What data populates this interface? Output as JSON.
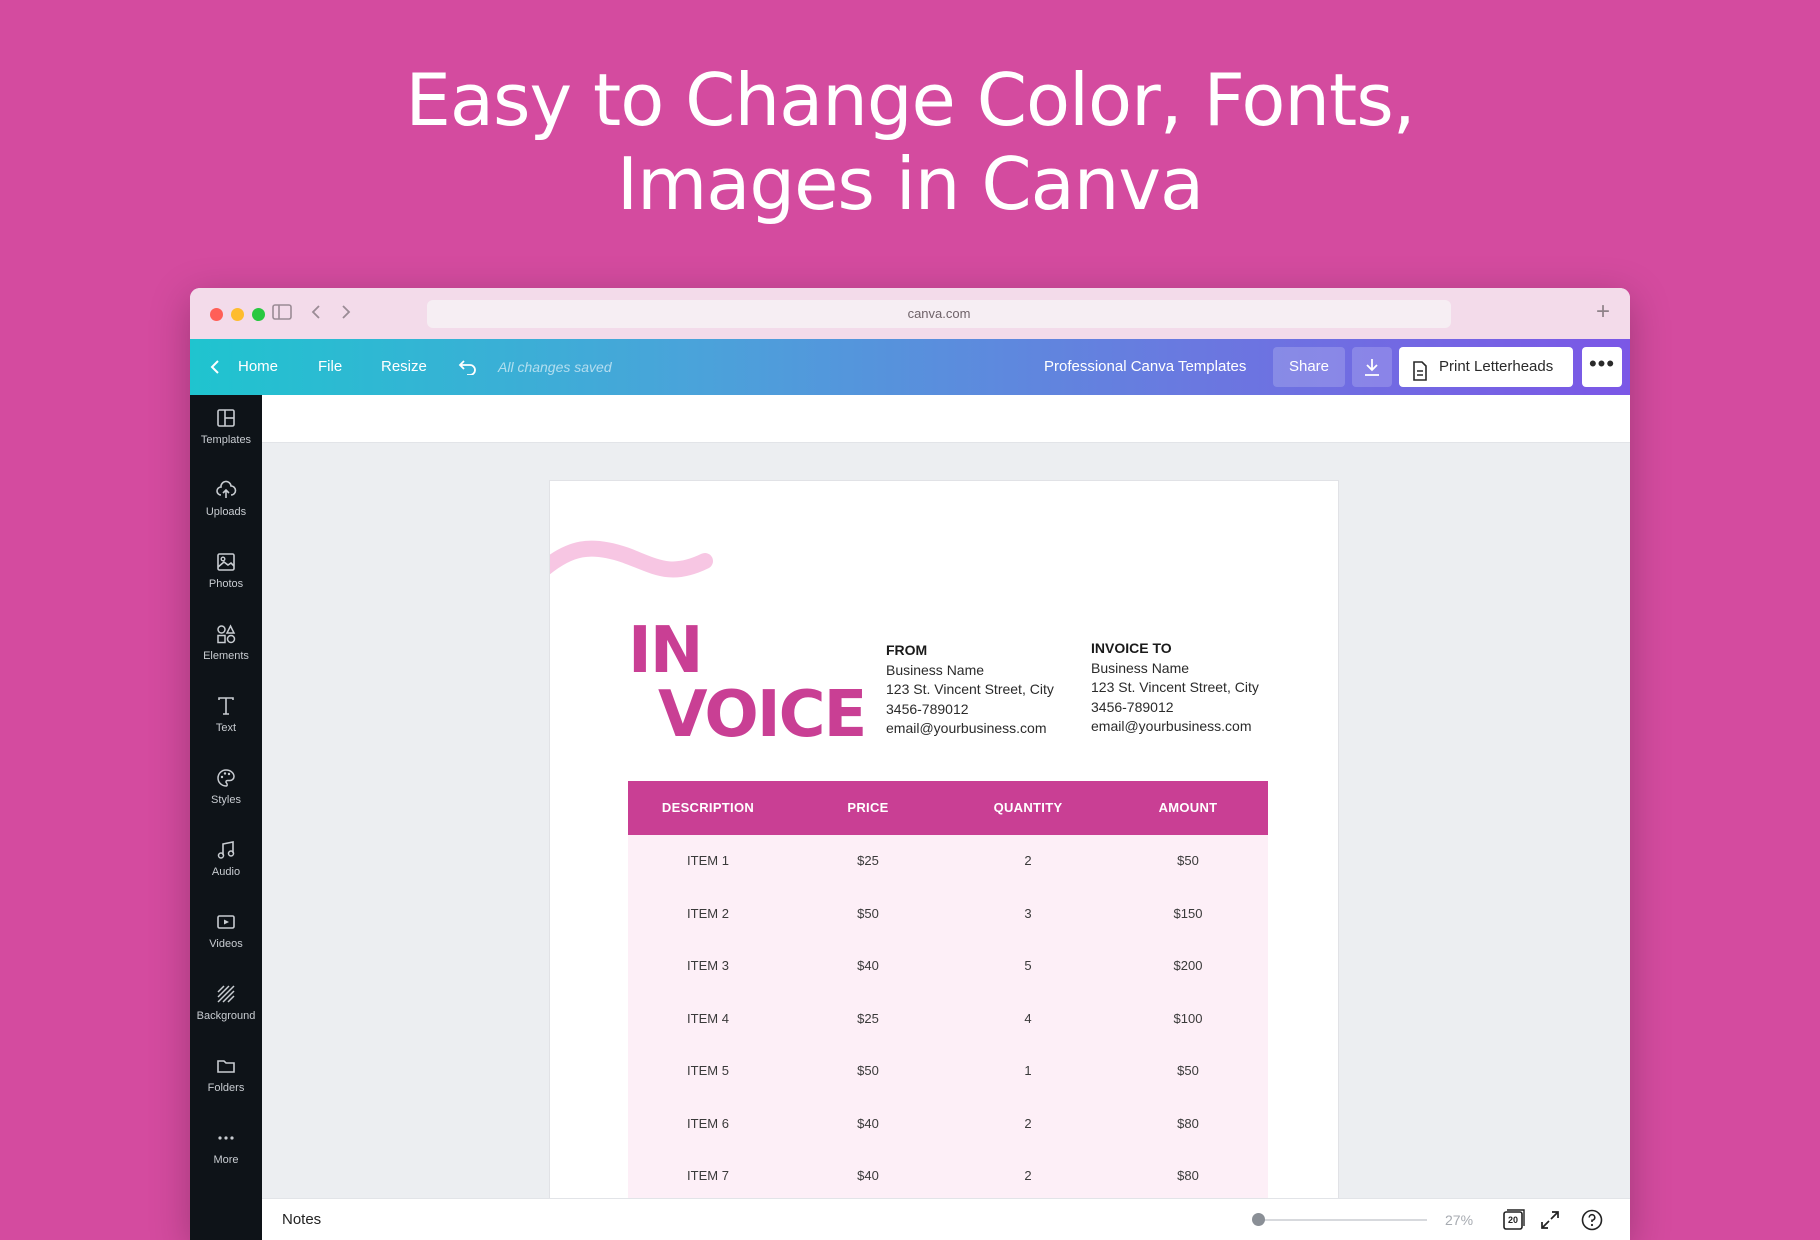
{
  "headline": {
    "line1": "Easy to Change Color, Fonts,",
    "line2": "Images in Canva"
  },
  "browser": {
    "url": "canva.com"
  },
  "toolbar": {
    "home_label": "Home",
    "file_label": "File",
    "resize_label": "Resize",
    "saved_status": "All changes saved",
    "document_title": "Professional Canva Templates",
    "share_label": "Share",
    "print_label": "Print Letterheads"
  },
  "sidebar": {
    "items": [
      {
        "label": "Templates",
        "icon": "templates-icon"
      },
      {
        "label": "Uploads",
        "icon": "upload-cloud-icon"
      },
      {
        "label": "Photos",
        "icon": "photo-icon"
      },
      {
        "label": "Elements",
        "icon": "elements-icon"
      },
      {
        "label": "Text",
        "icon": "text-icon"
      },
      {
        "label": "Styles",
        "icon": "palette-icon"
      },
      {
        "label": "Audio",
        "icon": "music-note-icon"
      },
      {
        "label": "Videos",
        "icon": "video-icon"
      },
      {
        "label": "Background",
        "icon": "background-icon"
      },
      {
        "label": "Folders",
        "icon": "folder-icon"
      },
      {
        "label": "More",
        "icon": "more-dots-icon"
      }
    ]
  },
  "invoice": {
    "title_line1": "IN",
    "title_line2": "VOICE",
    "accent_color": "#c93f94",
    "from": {
      "heading": "FROM",
      "name": "Business Name",
      "street": "123 St. Vincent Street, City",
      "phone": "3456-789012",
      "email": "email@yourbusiness.com"
    },
    "to": {
      "heading": "INVOICE TO",
      "name": "Business Name",
      "street": "123 St. Vincent Street, City",
      "phone": "3456-789012",
      "email": "email@yourbusiness.com"
    },
    "columns": [
      "DESCRIPTION",
      "PRICE",
      "QUANTITY",
      "AMOUNT"
    ],
    "rows": [
      [
        "ITEM 1",
        "$25",
        "2",
        "$50"
      ],
      [
        "ITEM 2",
        "$50",
        "3",
        "$150"
      ],
      [
        "ITEM 3",
        "$40",
        "5",
        "$200"
      ],
      [
        "ITEM 4",
        "$25",
        "4",
        "$100"
      ],
      [
        "ITEM 5",
        "$50",
        "1",
        "$50"
      ],
      [
        "ITEM 6",
        "$40",
        "2",
        "$80"
      ],
      [
        "ITEM 7",
        "$40",
        "2",
        "$80"
      ]
    ]
  },
  "bottombar": {
    "notes_label": "Notes",
    "zoom_level": "27%",
    "page_count": "20"
  }
}
